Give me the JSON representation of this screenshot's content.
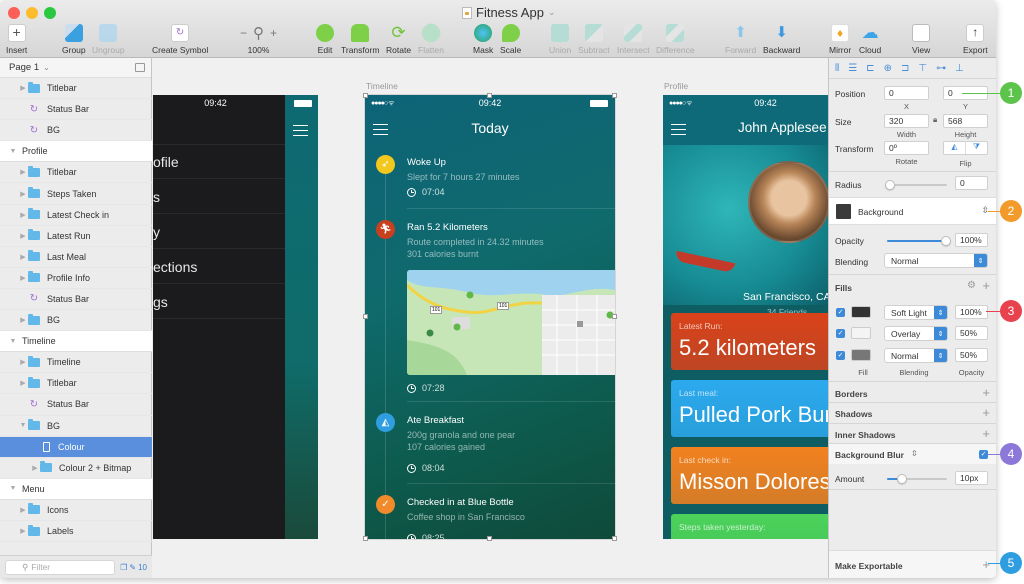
{
  "window": {
    "title": "Fitness App",
    "traffic_lights": {
      "close": "#fc5f57",
      "minimize": "#fdbc2e",
      "zoom": "#28c840"
    }
  },
  "toolbar": {
    "items": [
      {
        "label": "Insert",
        "icon": "plus-icon",
        "enabled": true
      },
      {
        "label": "Group",
        "icon": "group-icon",
        "enabled": true
      },
      {
        "label": "Ungroup",
        "icon": "ungroup-icon",
        "enabled": false
      },
      {
        "label": "Create Symbol",
        "icon": "symbol-icon",
        "enabled": true
      },
      {
        "label": "100%",
        "icon": "zoom-icon",
        "enabled": true
      },
      {
        "label": "Edit",
        "icon": "edit-icon",
        "enabled": true
      },
      {
        "label": "Transform",
        "icon": "transform-icon",
        "enabled": true
      },
      {
        "label": "Rotate",
        "icon": "rotate-icon",
        "enabled": true
      },
      {
        "label": "Flatten",
        "icon": "flatten-icon",
        "enabled": false
      },
      {
        "label": "Mask",
        "icon": "mask-icon",
        "enabled": true
      },
      {
        "label": "Scale",
        "icon": "scale-icon",
        "enabled": true
      },
      {
        "label": "Union",
        "icon": "union-icon",
        "enabled": false
      },
      {
        "label": "Subtract",
        "icon": "subtract-icon",
        "enabled": false
      },
      {
        "label": "Intersect",
        "icon": "intersect-icon",
        "enabled": false
      },
      {
        "label": "Difference",
        "icon": "difference-icon",
        "enabled": false
      },
      {
        "label": "Forward",
        "icon": "forward-icon",
        "enabled": false
      },
      {
        "label": "Backward",
        "icon": "backward-icon",
        "enabled": true
      },
      {
        "label": "Mirror",
        "icon": "mirror-icon",
        "enabled": true
      },
      {
        "label": "Cloud",
        "icon": "cloud-icon",
        "enabled": true
      },
      {
        "label": "View",
        "icon": "view-icon",
        "enabled": true
      },
      {
        "label": "Export",
        "icon": "export-icon",
        "enabled": true
      }
    ]
  },
  "sidebar": {
    "page": "Page 1",
    "layers": [
      {
        "label": "Titlebar",
        "type": "folder",
        "indent": 1
      },
      {
        "label": "Status Bar",
        "type": "symbol",
        "indent": 1
      },
      {
        "label": "BG",
        "type": "symbol",
        "indent": 1
      },
      {
        "label": "Profile",
        "type": "artboard",
        "indent": 0
      },
      {
        "label": "Titlebar",
        "type": "folder",
        "indent": 1
      },
      {
        "label": "Steps Taken",
        "type": "folder",
        "indent": 1
      },
      {
        "label": "Latest Check in",
        "type": "folder",
        "indent": 1
      },
      {
        "label": "Latest Run",
        "type": "folder",
        "indent": 1
      },
      {
        "label": "Last Meal",
        "type": "folder",
        "indent": 1
      },
      {
        "label": "Profile Info",
        "type": "folder",
        "indent": 1
      },
      {
        "label": "Status Bar",
        "type": "symbol",
        "indent": 1
      },
      {
        "label": "BG",
        "type": "folder",
        "indent": 1
      },
      {
        "label": "Timeline",
        "type": "artboard",
        "indent": 0
      },
      {
        "label": "Timeline",
        "type": "folder",
        "indent": 1
      },
      {
        "label": "Titlebar",
        "type": "folder",
        "indent": 1
      },
      {
        "label": "Status Bar",
        "type": "symbol",
        "indent": 1
      },
      {
        "label": "BG",
        "type": "folder-open",
        "indent": 1
      },
      {
        "label": "Colour",
        "type": "rect",
        "indent": 2,
        "selected": true
      },
      {
        "label": "Colour 2 + Bitmap",
        "type": "folder",
        "indent": 2
      },
      {
        "label": "Menu",
        "type": "artboard",
        "indent": 0
      },
      {
        "label": "Icons",
        "type": "folder",
        "indent": 1
      },
      {
        "label": "Labels",
        "type": "folder",
        "indent": 1
      }
    ],
    "filter_placeholder": "Filter",
    "footer_count": "10"
  },
  "canvas": {
    "menu_artboard": {
      "time": "09:42",
      "items": [
        "ofile",
        "s",
        "y",
        "ections",
        "gs"
      ]
    },
    "timeline_artboard": {
      "label": "Timeline",
      "time": "09:42",
      "header": "Today",
      "entries": [
        {
          "title": "Woke Up",
          "lines": [
            "Slept for 7 hours 27 minutes"
          ],
          "time": "07:04",
          "icon": "rocket-icon",
          "color": "#f2c81e"
        },
        {
          "title": "Ran 5.2 Kilometers",
          "lines": [
            "Route completed in 24.32 minutes",
            "301 calories burnt"
          ],
          "time": "07:28",
          "icon": "runner-icon",
          "color": "#c8401e"
        },
        {
          "title": "Ate Breakfast",
          "lines": [
            "200g granola and one pear",
            "107 calories gained"
          ],
          "time": "08:04",
          "icon": "pizza-icon",
          "color": "#2f9ee0"
        },
        {
          "title": "Checked in at Blue Bottle",
          "lines": [
            "Coffee shop in San Francisco"
          ],
          "time": "08:25",
          "icon": "check-icon",
          "color": "#f08a2a"
        }
      ],
      "map_labels": [
        "101",
        "101"
      ]
    },
    "profile_artboard": {
      "label": "Profile",
      "time": "09:42",
      "name": "John Applesee",
      "location": "San Francisco, CA",
      "friends": "34 Friends",
      "cards": [
        {
          "label": "Latest Run:",
          "value": "5.2 kilometers",
          "color": "#d9421a"
        },
        {
          "label": "Last meal:",
          "value": "Pulled Pork Burr",
          "color": "#2ca9ee"
        },
        {
          "label": "Last check in:",
          "value": "Misson Dolores",
          "color": "#f2811f"
        },
        {
          "label": "Steps taken yesterday:",
          "value": "",
          "color": "#4cd25a"
        }
      ]
    }
  },
  "inspector": {
    "position": {
      "label": "Position",
      "x": "0",
      "y": "0",
      "x_label": "X",
      "y_label": "Y"
    },
    "size": {
      "label": "Size",
      "width": "320",
      "height": "568",
      "w_label": "Width",
      "h_label": "Height"
    },
    "transform": {
      "label": "Transform",
      "rotate": "0º",
      "rotate_label": "Rotate",
      "flip_label": "Flip"
    },
    "radius": {
      "label": "Radius",
      "value": "0"
    },
    "style": {
      "name": "Background"
    },
    "opacity": {
      "label": "Opacity",
      "value": "100%",
      "level": 1.0
    },
    "blending": {
      "label": "Blending",
      "value": "Normal"
    },
    "fills": {
      "title": "Fills",
      "items": [
        {
          "enabled": true,
          "blend": "Soft Light",
          "opacity": "100%",
          "swatch": "#333333"
        },
        {
          "enabled": true,
          "blend": "Overlay",
          "opacity": "50%",
          "swatch": "#f4f4f4"
        },
        {
          "enabled": true,
          "blend": "Normal",
          "opacity": "50%",
          "swatch": "#777777"
        }
      ],
      "col_fill": "Fill",
      "col_blend": "Blending",
      "col_opacity": "Opacity"
    },
    "borders": "Borders",
    "shadows": "Shadows",
    "inner_shadows": "Inner Shadows",
    "background_blur": {
      "title": "Background Blur",
      "enabled": true,
      "amount_label": "Amount",
      "amount": "10px",
      "level": 0.25
    },
    "export": "Make Exportable"
  },
  "callouts": [
    {
      "number": "1",
      "color": "#5dc44b"
    },
    {
      "number": "2",
      "color": "#f29a2a"
    },
    {
      "number": "3",
      "color": "#e8424e"
    },
    {
      "number": "4",
      "color": "#8b78d8"
    },
    {
      "number": "5",
      "color": "#2f9ee0"
    }
  ]
}
